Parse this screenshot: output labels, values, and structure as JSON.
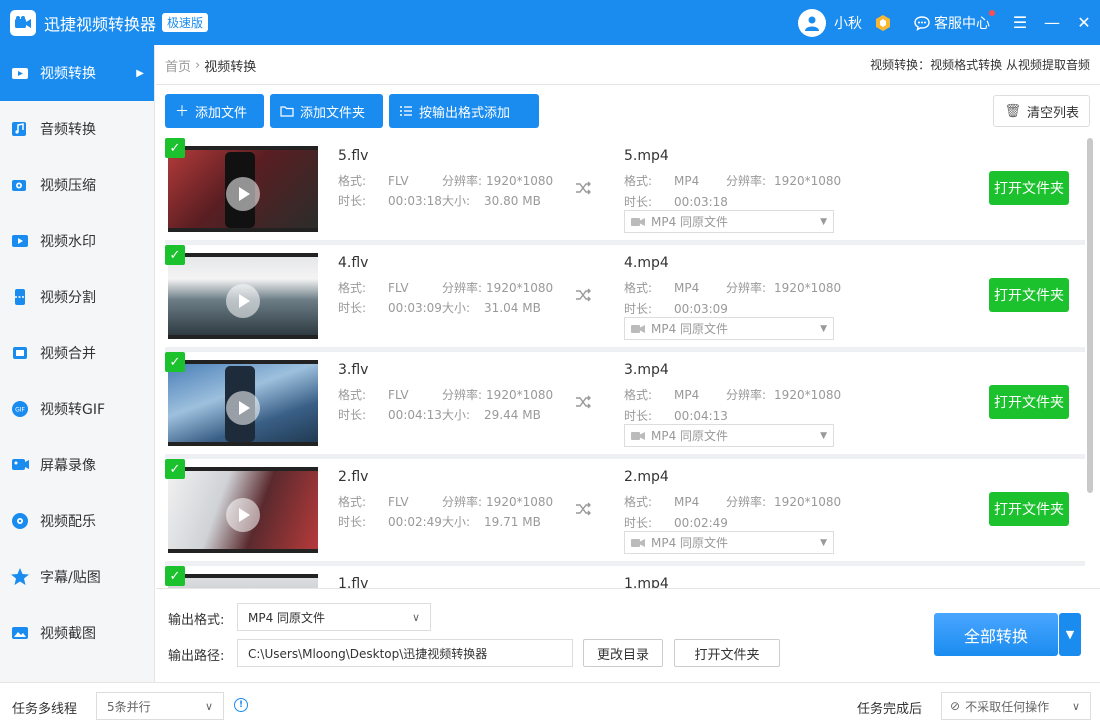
{
  "app": {
    "title": "迅捷视频转换器",
    "edition": "极速版",
    "username": "小秋",
    "service_label": "客服中心",
    "logo_icon": "video-camera-logo-icon"
  },
  "sidebar": {
    "items": [
      {
        "label": "视频转换",
        "icon": "video-convert-icon",
        "active": true
      },
      {
        "label": "音频转换",
        "icon": "audio-convert-icon"
      },
      {
        "label": "视频压缩",
        "icon": "video-compress-icon"
      },
      {
        "label": "视频水印",
        "icon": "video-watermark-icon"
      },
      {
        "label": "视频分割",
        "icon": "video-split-icon"
      },
      {
        "label": "视频合并",
        "icon": "video-merge-icon"
      },
      {
        "label": "视频转GIF",
        "icon": "video-to-gif-icon"
      },
      {
        "label": "屏幕录像",
        "icon": "screen-record-icon"
      },
      {
        "label": "视频配乐",
        "icon": "video-music-icon"
      },
      {
        "label": "字幕/贴图",
        "icon": "subtitle-sticker-icon"
      },
      {
        "label": "视频截图",
        "icon": "video-screenshot-icon"
      }
    ]
  },
  "breadcrumb": {
    "home": "首页",
    "separator": "›",
    "current": "视频转换"
  },
  "hint": "视频转换：视频格式转换 从视频提取音频",
  "toolbar": {
    "add_file": "添加文件",
    "add_folder": "添加文件夹",
    "add_by_format": "按输出格式添加",
    "clear_list": "清空列表"
  },
  "labels": {
    "format": "格式:",
    "duration": "时长:",
    "resolution": "分辨率:",
    "size": "大小:",
    "open_folder": "打开文件夹",
    "same_as_source": "同原文件"
  },
  "files": [
    {
      "name": "5.flv",
      "format": "FLV",
      "duration": "00:03:18",
      "resolution": "1920*1080",
      "size": "30.80 MB",
      "out_name": "5.mp4",
      "out_format": "MP4",
      "out_resolution": "1920*1080",
      "out_duration": "00:03:18",
      "out_select": "MP4  同原文件"
    },
    {
      "name": "4.flv",
      "format": "FLV",
      "duration": "00:03:09",
      "resolution": "1920*1080",
      "size": "31.04 MB",
      "out_name": "4.mp4",
      "out_format": "MP4",
      "out_resolution": "1920*1080",
      "out_duration": "00:03:09",
      "out_select": "MP4  同原文件"
    },
    {
      "name": "3.flv",
      "format": "FLV",
      "duration": "00:04:13",
      "resolution": "1920*1080",
      "size": "29.44 MB",
      "out_name": "3.mp4",
      "out_format": "MP4",
      "out_resolution": "1920*1080",
      "out_duration": "00:04:13",
      "out_select": "MP4  同原文件"
    },
    {
      "name": "2.flv",
      "format": "FLV",
      "duration": "00:02:49",
      "resolution": "1920*1080",
      "size": "19.71 MB",
      "out_name": "2.mp4",
      "out_format": "MP4",
      "out_resolution": "1920*1080",
      "out_duration": "00:02:49",
      "out_select": "MP4  同原文件"
    },
    {
      "name": "1.flv",
      "out_name": "1.mp4"
    }
  ],
  "bottom": {
    "output_format_label": "输出格式:",
    "output_format_value": "MP4  同原文件",
    "output_path_label": "输出路径:",
    "output_path_value": "C:\\Users\\Mloong\\Desktop\\迅捷视频转换器",
    "change_dir": "更改目录",
    "open_folder": "打开文件夹",
    "convert_all": "全部转换"
  },
  "statusbar": {
    "multithread_label": "任务多线程",
    "multithread_value": "5条并行",
    "after_complete_label": "任务完成后",
    "after_complete_value": "不采取任何操作"
  },
  "colors": {
    "brand": "#1a8cf0",
    "open_green": "#1cc22e",
    "check_green": "#1cc22e"
  }
}
